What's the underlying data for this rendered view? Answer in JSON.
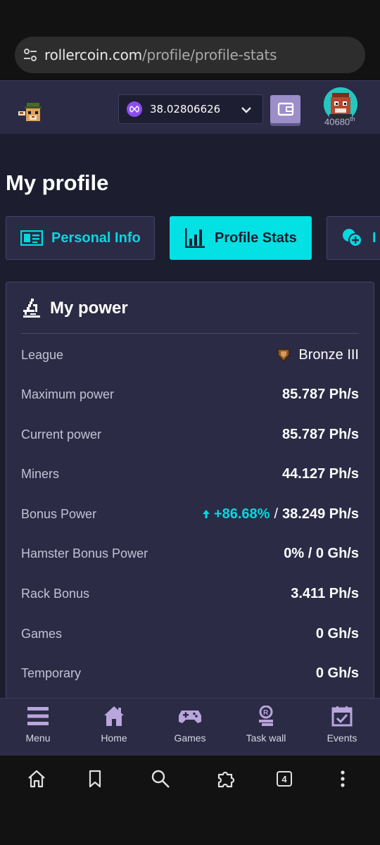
{
  "browser": {
    "url_host": "rollercoin.com",
    "url_path": "/profile/profile-stats",
    "tab_count": "4"
  },
  "header": {
    "balance": "38.02806626",
    "rank": "40680",
    "rank_suffix": "th"
  },
  "page": {
    "title": "My profile",
    "tabs": [
      {
        "label": "Personal Info",
        "active": false
      },
      {
        "label": "Profile Stats",
        "active": true
      },
      {
        "label": "I",
        "active": false
      }
    ]
  },
  "power": {
    "title": "My power",
    "league_label": "League",
    "league_value": "Bronze III",
    "rows": [
      {
        "label": "Maximum power",
        "value": "85.787 Ph/s"
      },
      {
        "label": "Current power",
        "value": "85.787 Ph/s"
      },
      {
        "label": "Miners",
        "value": "44.127 Ph/s"
      }
    ],
    "bonus_label": "Bonus Power",
    "bonus_percent": "+86.68%",
    "bonus_sep": "/",
    "bonus_value": "38.249 Ph/s",
    "rows2": [
      {
        "label": "Hamster Bonus Power",
        "value": "0% / 0 Gh/s"
      },
      {
        "label": "Rack Bonus",
        "value": "3.411 Ph/s"
      },
      {
        "label": "Games",
        "value": "0 Gh/s"
      },
      {
        "label": "Temporary",
        "value": "0 Gh/s"
      }
    ]
  },
  "bottom_nav": [
    {
      "label": "Menu",
      "icon": "menu-icon"
    },
    {
      "label": "Home",
      "icon": "home-icon"
    },
    {
      "label": "Games",
      "icon": "gamepad-icon"
    },
    {
      "label": "Task wall",
      "icon": "task-wall-icon"
    },
    {
      "label": "Events",
      "icon": "calendar-icon"
    }
  ],
  "colors": {
    "accent": "#03e1e4",
    "panel": "#2b2b45",
    "background": "#1c1d2f",
    "coin": "#8a4df2"
  }
}
